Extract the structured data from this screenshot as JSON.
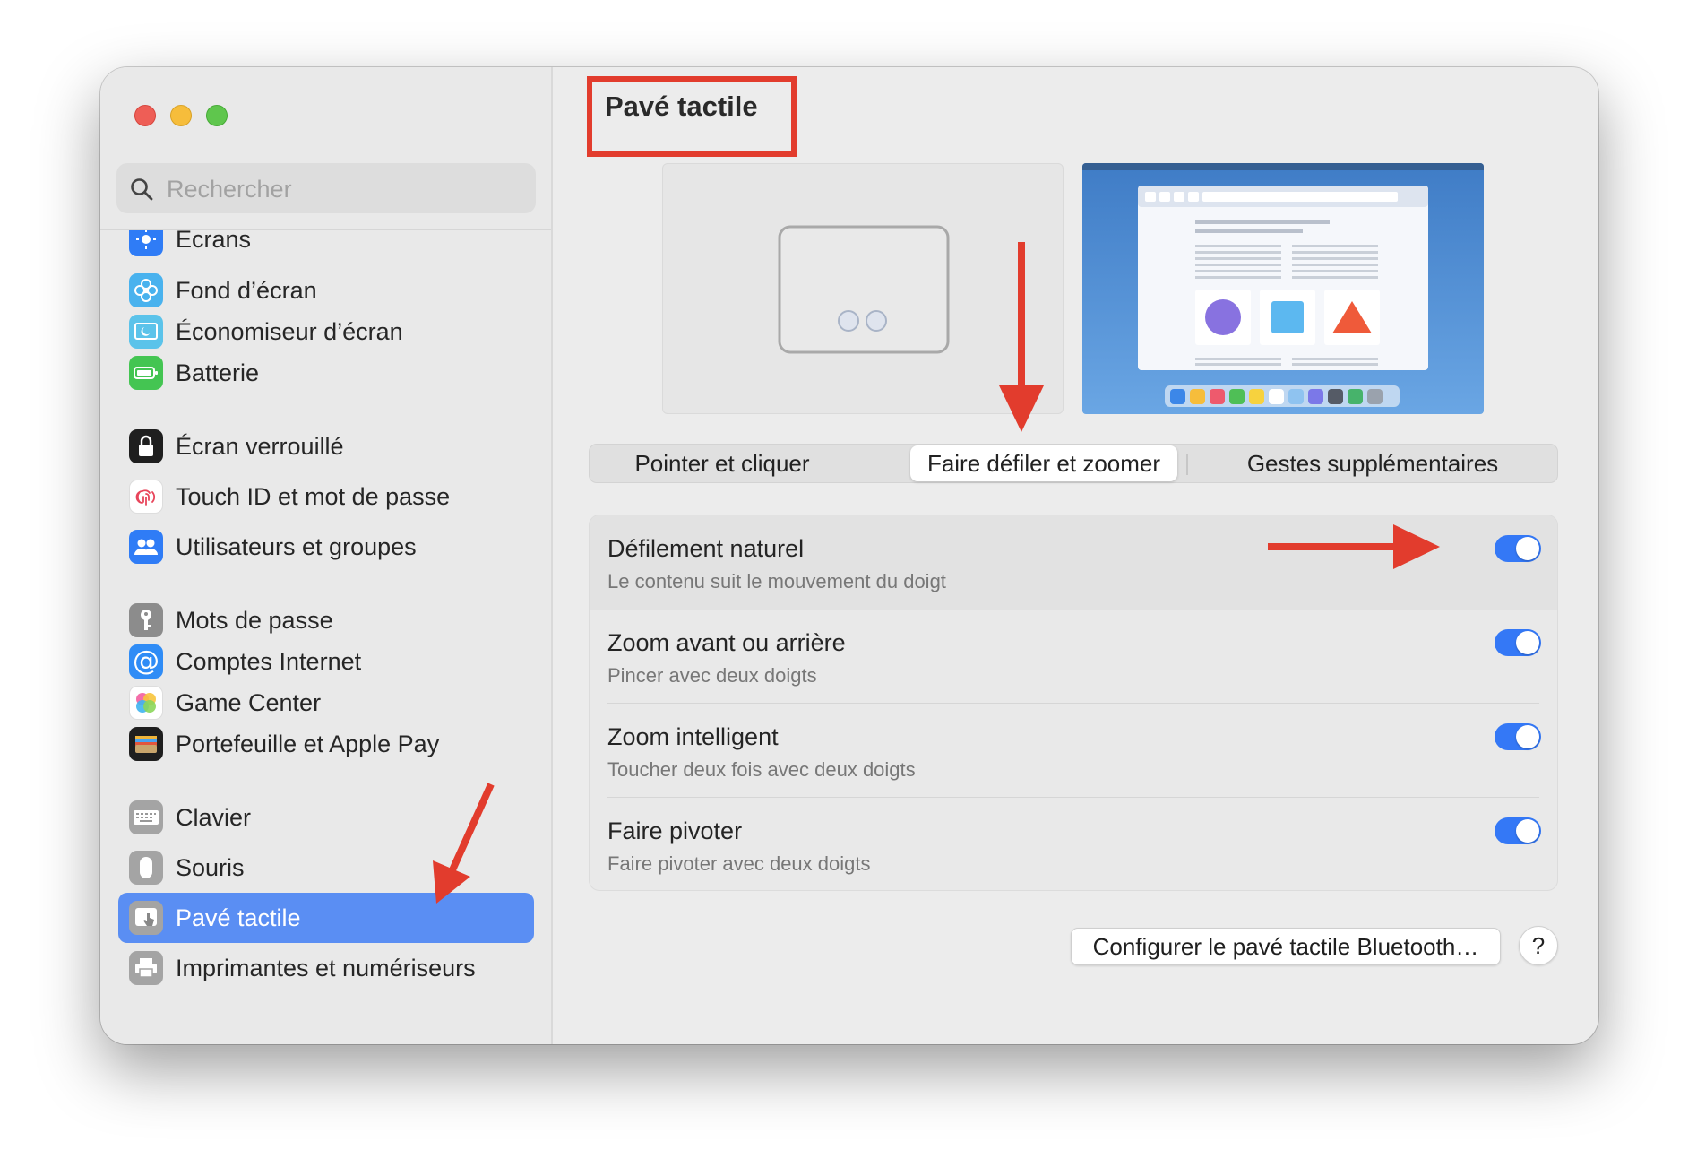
{
  "window": {
    "traffic_lights": [
      "close",
      "minimize",
      "zoom"
    ]
  },
  "search": {
    "placeholder": "Rechercher",
    "icon": "magnifier-icon"
  },
  "sidebar": {
    "items": [
      {
        "label": "Écrans",
        "icon": "displays-icon",
        "color": "#2f7cf6"
      },
      {
        "label": "Fond d’écran",
        "icon": "wallpaper-flower-icon",
        "color": "#49b2ee"
      },
      {
        "label": "Économiseur d’écran",
        "icon": "screensaver-icon",
        "color": "#5bc3ea"
      },
      {
        "label": "Batterie",
        "icon": "battery-icon",
        "color": "#44c552"
      },
      {
        "label": "Écran verrouillé",
        "icon": "lock-icon",
        "color": "#1f1f1f"
      },
      {
        "label": "Touch ID et mot de passe",
        "icon": "fingerprint-icon",
        "color": "#ffffff"
      },
      {
        "label": "Utilisateurs et groupes",
        "icon": "users-icon",
        "color": "#2f7cf6"
      },
      {
        "label": "Mots de passe",
        "icon": "key-icon",
        "color": "#8c8c8c"
      },
      {
        "label": "Comptes Internet",
        "icon": "at-sign-icon",
        "color": "#2f8cf6"
      },
      {
        "label": "Game Center",
        "icon": "game-center-icon",
        "color": "#ffffff"
      },
      {
        "label": "Portefeuille et Apple Pay",
        "icon": "wallet-icon",
        "color": "#1f1f1f"
      },
      {
        "label": "Clavier",
        "icon": "keyboard-icon",
        "color": "#9a9a9a"
      },
      {
        "label": "Souris",
        "icon": "mouse-icon",
        "color": "#9a9a9a"
      },
      {
        "label": "Pavé tactile",
        "icon": "trackpad-icon",
        "color": "#9a9a9a",
        "selected": true
      },
      {
        "label": "Imprimantes et numériseurs",
        "icon": "printer-icon",
        "color": "#9a9a9a"
      }
    ]
  },
  "main": {
    "title": "Pavé tactile",
    "tabs": [
      {
        "label": "Pointer et cliquer",
        "active": false
      },
      {
        "label": "Faire défiler et zoomer",
        "active": true
      },
      {
        "label": "Gestes supplémentaires",
        "active": false
      }
    ],
    "settings": [
      {
        "title": "Défilement naturel",
        "subtitle": "Le contenu suit le mouvement du doigt",
        "enabled": true
      },
      {
        "title": "Zoom avant ou arrière",
        "subtitle": "Pincer avec deux doigts",
        "enabled": true
      },
      {
        "title": "Zoom intelligent",
        "subtitle": "Toucher deux fois avec deux doigts",
        "enabled": true
      },
      {
        "title": "Faire pivoter",
        "subtitle": "Faire pivoter avec deux doigts",
        "enabled": true
      }
    ],
    "bluetooth_button": "Configurer le pavé tactile Bluetooth…",
    "help_button": "?"
  },
  "colors": {
    "accent": "#3478f6",
    "sidebar_selection": "#5a8ef3",
    "annotation": "#e23c2d"
  }
}
